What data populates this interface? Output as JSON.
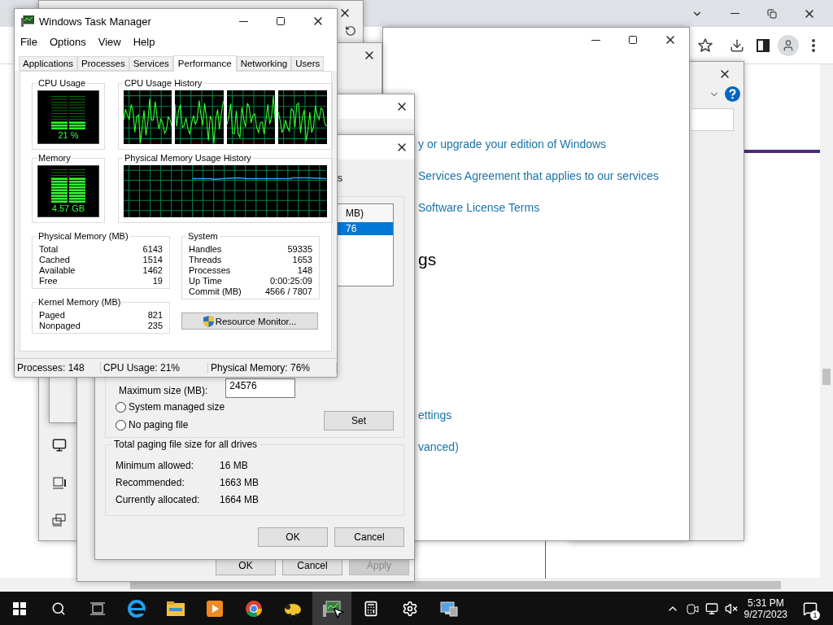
{
  "settings_window": {
    "links_upper": [
      "y or upgrade your edition of Windows",
      "Services Agreement that applies to our services",
      "Software License Terms"
    ],
    "heading": "gs",
    "links_lower": [
      "ettings",
      "vanced)"
    ]
  },
  "system_properties": {
    "buttons": [
      {
        "label": "OK",
        "disabled": false
      },
      {
        "label": "Cancel",
        "disabled": false
      },
      {
        "label": "Apply",
        "disabled": true
      }
    ]
  },
  "virtual_memory": {
    "fragment": "s",
    "list_header": "MB)",
    "list_rows": [
      {
        "text": "76",
        "selected": true
      }
    ],
    "maximum_size": {
      "label": "Maximum size (MB):",
      "value": "24576"
    },
    "options": [
      {
        "label": "System managed size",
        "selected": false
      },
      {
        "label": "No paging file",
        "selected": false
      }
    ],
    "set_button": "Set",
    "totals": {
      "title": "Total paging file size for all drives",
      "rows": [
        {
          "label": "Minimum allowed:",
          "value": "16 MB"
        },
        {
          "label": "Recommended:",
          "value": "1663 MB"
        },
        {
          "label": "Currently allocated:",
          "value": "1664 MB"
        }
      ]
    },
    "buttons": [
      "OK",
      "Cancel"
    ]
  },
  "task_manager": {
    "title": "Windows Task Manager",
    "menu": [
      "File",
      "Options",
      "View",
      "Help"
    ],
    "tabs": [
      {
        "label": "Applications",
        "selected": false
      },
      {
        "label": "Processes",
        "selected": false
      },
      {
        "label": "Services",
        "selected": false
      },
      {
        "label": "Performance",
        "selected": true
      },
      {
        "label": "Networking",
        "selected": false
      },
      {
        "label": "Users",
        "selected": false
      }
    ],
    "cpu_usage": {
      "title": "CPU Usage",
      "reading": "21 %",
      "level": 0.21
    },
    "cpu_history": {
      "title": "CPU Usage History"
    },
    "memory": {
      "title": "Memory",
      "reading": "4.57 GB",
      "level": 0.76
    },
    "memory_history": {
      "title": "Physical Memory Usage History"
    },
    "physical_memory": {
      "title": "Physical Memory (MB)",
      "rows": [
        {
          "label": "Total",
          "value": "6143"
        },
        {
          "label": "Cached",
          "value": "1514"
        },
        {
          "label": "Available",
          "value": "1462"
        },
        {
          "label": "Free",
          "value": "19"
        }
      ]
    },
    "kernel_memory": {
      "title": "Kernel Memory (MB)",
      "rows": [
        {
          "label": "Paged",
          "value": "821"
        },
        {
          "label": "Nonpaged",
          "value": "235"
        }
      ]
    },
    "system": {
      "title": "System",
      "rows": [
        {
          "label": "Handles",
          "value": "59335"
        },
        {
          "label": "Threads",
          "value": "1653"
        },
        {
          "label": "Processes",
          "value": "148"
        },
        {
          "label": "Up Time",
          "value": "0:00:25:09"
        },
        {
          "label": "Commit (MB)",
          "value": "4566 / 7807"
        }
      ]
    },
    "resource_monitor_button": "Resource Monitor...",
    "status_bar": [
      "Processes: 148",
      "CPU Usage: 21%",
      "Physical Memory: 76%"
    ]
  },
  "taskbar": {
    "time": "5:31 PM",
    "date": "9/27/2023",
    "notification_count": "1"
  }
}
